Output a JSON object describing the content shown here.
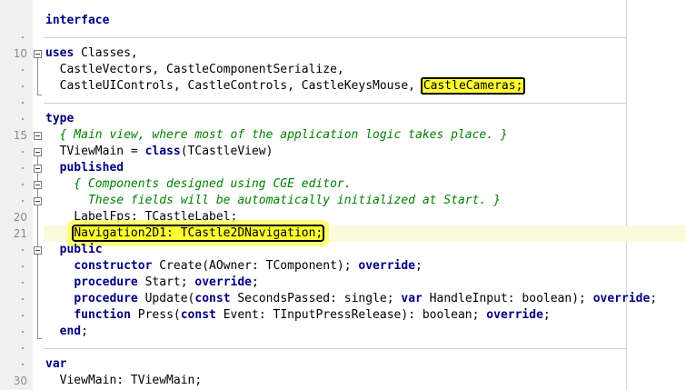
{
  "gutter": {
    "line_numbers": {
      "l10": "10",
      "l15": "15",
      "l20": "20",
      "l21": "21",
      "l30": "30"
    }
  },
  "code": {
    "interface_kw": "interface",
    "uses_kw": "uses",
    "uses_line1_rest": " Classes,",
    "uses_line2": "  CastleVectors, CastleComponentSerialize,",
    "uses_line3_prefix": "  CastleUIControls, CastleControls, CastleKeysMouse, ",
    "highlight_castle_cameras": "CastleCameras;",
    "type_kw": "type",
    "comment_main_view": "  { Main view, where most of the application logic takes place. }",
    "class_decl_prefix": "  TViewMain = ",
    "class_kw": "class",
    "class_decl_suffix": "(TCastleView)",
    "published_indent": "  ",
    "published_kw": "published",
    "comment_components_1": "    { Components designed using CGE editor.",
    "comment_components_2": "      These fields will be automatically initialized at Start. }",
    "label_fps_line": "    LabelFps: TCastleLabel;",
    "nav_indent": "    ",
    "highlight_navigation": "Navigation2D1: TCastle2DNavigation;",
    "public_indent": "  ",
    "public_kw": "public",
    "ctor_indent": "    ",
    "ctor_kw": "constructor",
    "ctor_mid": " Create(AOwner: TComponent); ",
    "ctor_override": "override",
    "ctor_end": ";",
    "start_indent": "    ",
    "start_kw": "procedure",
    "start_mid": " Start; ",
    "start_override": "override",
    "start_end": ";",
    "update_indent": "    ",
    "update_kw": "procedure",
    "update_mid1": " Update(",
    "update_const": "const",
    "update_mid2": " SecondsPassed: single; ",
    "update_var": "var",
    "update_mid3": " HandleInput: boolean); ",
    "update_override": "override",
    "update_end": ";",
    "press_indent": "    ",
    "press_kw": "function",
    "press_mid1": " Press(",
    "press_const": "const",
    "press_mid2": " Event: TInputPressRelease): boolean; ",
    "press_override": "override",
    "press_end": ";",
    "end_indent": "  ",
    "end_kw": "end",
    "end_semicolon": ";",
    "var_kw": "var",
    "view_main_line": "  ViewMain: TViewMain;"
  },
  "colors": {
    "keyword": "#000080",
    "comment": "#008000",
    "highlight": "#ffff33",
    "current_line": "#fbfbdc"
  }
}
